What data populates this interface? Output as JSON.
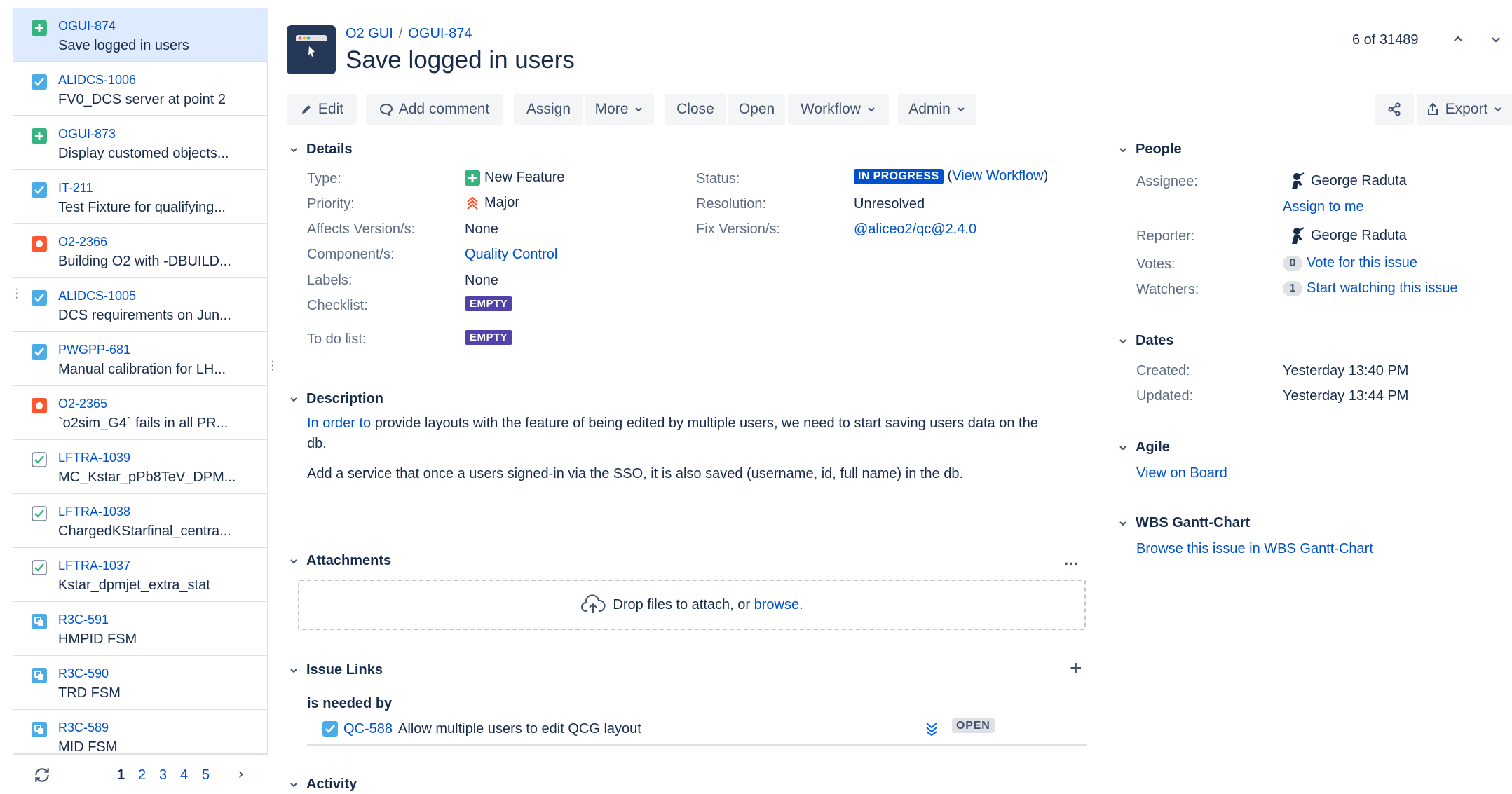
{
  "issue_list": {
    "items": [
      {
        "key": "OGUI-874",
        "summary": "Save logged in users",
        "type": "new-feature",
        "selected": true
      },
      {
        "key": "ALIDCS-1006",
        "summary": "FV0_DCS server at point 2",
        "type": "task"
      },
      {
        "key": "OGUI-873",
        "summary": "Display customed objects...",
        "type": "new-feature"
      },
      {
        "key": "IT-211",
        "summary": "Test Fixture for qualifying...",
        "type": "task"
      },
      {
        "key": "O2-2366",
        "summary": "Building O2 with -DBUILD...",
        "type": "bug"
      },
      {
        "key": "ALIDCS-1005",
        "summary": "DCS requirements on Jun...",
        "type": "task"
      },
      {
        "key": "PWGPP-681",
        "summary": "Manual calibration for LH...",
        "type": "task"
      },
      {
        "key": "O2-2365",
        "summary": "`o2sim_G4` fails in all PR...",
        "type": "bug"
      },
      {
        "key": "LFTRA-1039",
        "summary": "MC_Kstar_pPb8TeV_DPM...",
        "type": "subtask"
      },
      {
        "key": "LFTRA-1038",
        "summary": "ChargedKStarfinal_centra...",
        "type": "subtask"
      },
      {
        "key": "LFTRA-1037",
        "summary": "Kstar_dpmjet_extra_stat",
        "type": "subtask"
      },
      {
        "key": "R3C-591",
        "summary": "HMPID FSM",
        "type": "sub-blue"
      },
      {
        "key": "R3C-590",
        "summary": "TRD FSM",
        "type": "sub-blue"
      },
      {
        "key": "R3C-589",
        "summary": "MID FSM",
        "type": "sub-blue"
      }
    ],
    "pages": [
      "1",
      "2",
      "3",
      "4",
      "5"
    ],
    "current_page": "1",
    "next_label": "›",
    "refresh_icon": "refresh-icon"
  },
  "header": {
    "project": "O2 GUI",
    "breadcrumb_sep": "/",
    "issue_key": "OGUI-874",
    "title": "Save logged in users",
    "pager_count": "6 of 31489"
  },
  "toolbar": {
    "edit": "Edit",
    "add_comment": "Add comment",
    "assign": "Assign",
    "more": "More",
    "close": "Close",
    "open": "Open",
    "workflow": "Workflow",
    "admin": "Admin",
    "export": "Export"
  },
  "details": {
    "heading": "Details",
    "type_label": "Type:",
    "type_value": "New Feature",
    "priority_label": "Priority:",
    "priority_value": "Major",
    "affects_label": "Affects Version/s:",
    "affects_value": "None",
    "component_label": "Component/s:",
    "component_value": "Quality Control",
    "labels_label": "Labels:",
    "labels_value": "None",
    "checklist_label": "Checklist:",
    "checklist_value": "EMPTY",
    "todo_label": "To do list:",
    "todo_value": "EMPTY",
    "status_label": "Status:",
    "status_value": "IN PROGRESS",
    "view_workflow_open": "(",
    "view_workflow": "View Workflow",
    "view_workflow_close": ")",
    "resolution_label": "Resolution:",
    "resolution_value": "Unresolved",
    "fix_label": "Fix Version/s:",
    "fix_value": "@aliceo2/qc@2.4.0"
  },
  "description": {
    "heading": "Description",
    "link_text": "In order to",
    "para1_rest": " provide layouts with the feature of being edited by multiple users, we need to start saving users data on the db.",
    "para2": "Add a service that once a users signed-in via the SSO, it is also saved (username, id, full name) in the db."
  },
  "attachments": {
    "heading": "Attachments",
    "more": "...",
    "drop_text": "Drop files to attach, or",
    "browse": "browse."
  },
  "issue_links": {
    "heading": "Issue Links",
    "add": "+",
    "relation": "is needed by",
    "link_key": "QC-588",
    "link_summary": "Allow multiple users to edit QCG layout",
    "link_status": "OPEN"
  },
  "activity": {
    "heading": "Activity"
  },
  "people": {
    "heading": "People",
    "assignee_label": "Assignee:",
    "assignee": "George Raduta",
    "assign_to_me": "Assign to me",
    "reporter_label": "Reporter:",
    "reporter": "George Raduta",
    "votes_label": "Votes:",
    "votes_count": "0",
    "vote_link": "Vote for this issue",
    "watchers_label": "Watchers:",
    "watchers_count": "1",
    "watch_link": "Start watching this issue"
  },
  "dates": {
    "heading": "Dates",
    "created_label": "Created:",
    "created": "Yesterday 13:40 PM",
    "updated_label": "Updated:",
    "updated": "Yesterday 13:44 PM"
  },
  "agile": {
    "heading": "Agile",
    "link": "View on Board"
  },
  "wbs": {
    "heading": "WBS Gantt-Chart",
    "link": "Browse this issue in WBS Gantt-Chart"
  },
  "colors": {
    "link": "#0052cc",
    "selected_row": "#deebff",
    "new_feature": "#36b37e",
    "task": "#4bade8",
    "bug": "#ff5630",
    "in_progress": "#0052cc",
    "empty_lozenge": "#5243aa"
  }
}
